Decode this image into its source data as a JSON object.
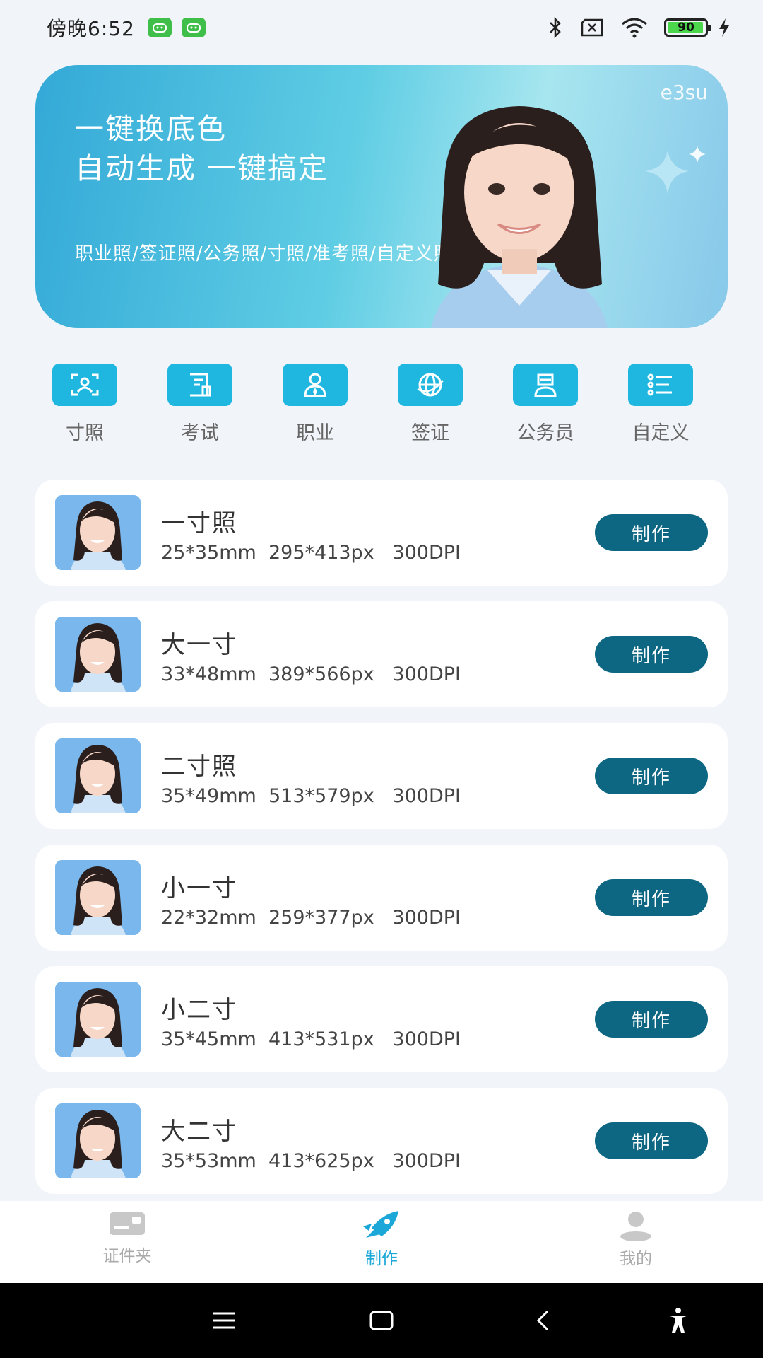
{
  "status_bar": {
    "time": "傍晚6:52",
    "battery": "90"
  },
  "banner": {
    "watermark": "e3su",
    "headline_line1": "一键换底色",
    "headline_line2": "自动生成 一键搞定",
    "subtitle": "职业照/签证照/公务照/寸照/准考照/自定义照片"
  },
  "categories": [
    {
      "label": "寸照",
      "icon": "portrait-frame-icon"
    },
    {
      "label": "考试",
      "icon": "exam-doc-icon"
    },
    {
      "label": "职业",
      "icon": "professional-person-icon"
    },
    {
      "label": "签证",
      "icon": "globe-icon"
    },
    {
      "label": "公务员",
      "icon": "civil-servant-icon"
    },
    {
      "label": "自定义",
      "icon": "custom-list-icon"
    }
  ],
  "sizes": [
    {
      "title": "一寸照",
      "specs": "25*35mm  295*413px   300DPI",
      "button": "制作"
    },
    {
      "title": "大一寸",
      "specs": "33*48mm  389*566px   300DPI",
      "button": "制作"
    },
    {
      "title": "二寸照",
      "specs": "35*49mm  513*579px   300DPI",
      "button": "制作"
    },
    {
      "title": "小一寸",
      "specs": "22*32mm  259*377px   300DPI",
      "button": "制作"
    },
    {
      "title": "小二寸",
      "specs": "35*45mm  413*531px   300DPI",
      "button": "制作"
    },
    {
      "title": "大二寸",
      "specs": "35*53mm  413*625px   300DPI",
      "button": "制作"
    }
  ],
  "tabbar": {
    "tabs": [
      {
        "label": "证件夹",
        "icon": "id-card-icon",
        "active": false
      },
      {
        "label": "制作",
        "icon": "make-rocket-icon",
        "active": true
      },
      {
        "label": "我的",
        "icon": "user-icon",
        "active": false
      }
    ]
  },
  "colors": {
    "accent": "#1fb7df",
    "button": "#0d6783",
    "active_tab": "#1ba8d8",
    "background": "#f1f4f8"
  }
}
